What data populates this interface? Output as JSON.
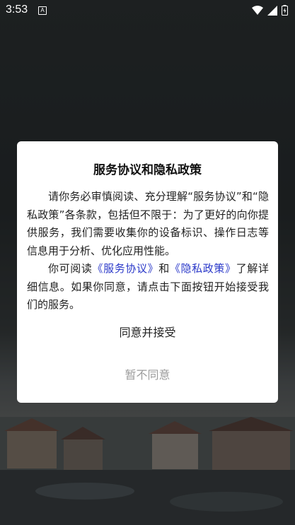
{
  "status_bar": {
    "time": "3:53",
    "app_icon_letter": "A",
    "icons": [
      "wifi-icon",
      "signal-icon",
      "battery-icon"
    ]
  },
  "dialog": {
    "title": "服务协议和隐私政策",
    "paragraph1": "请你务必审慎阅读、充分理解“服务协议”和“隐私政策”各条款，包括但不限于：为了更好的向你提供服务，我们需要收集你的设备标识、操作日志等信息用于分析、优化应用性能。",
    "p2_prefix": "你可阅读",
    "service_link": "《服务协议》",
    "p2_and": "和",
    "privacy_link": "《隐私政策》",
    "p2_suffix": "了解详细信息。如果你同意，请点击下面按钮开始接受我们的服务。",
    "agree_label": "同意并接受",
    "disagree_label": "暂不同意"
  },
  "colors": {
    "link": "#2a38c9",
    "disagree_text": "#9b9b9b",
    "dialog_bg": "#ffffff"
  }
}
